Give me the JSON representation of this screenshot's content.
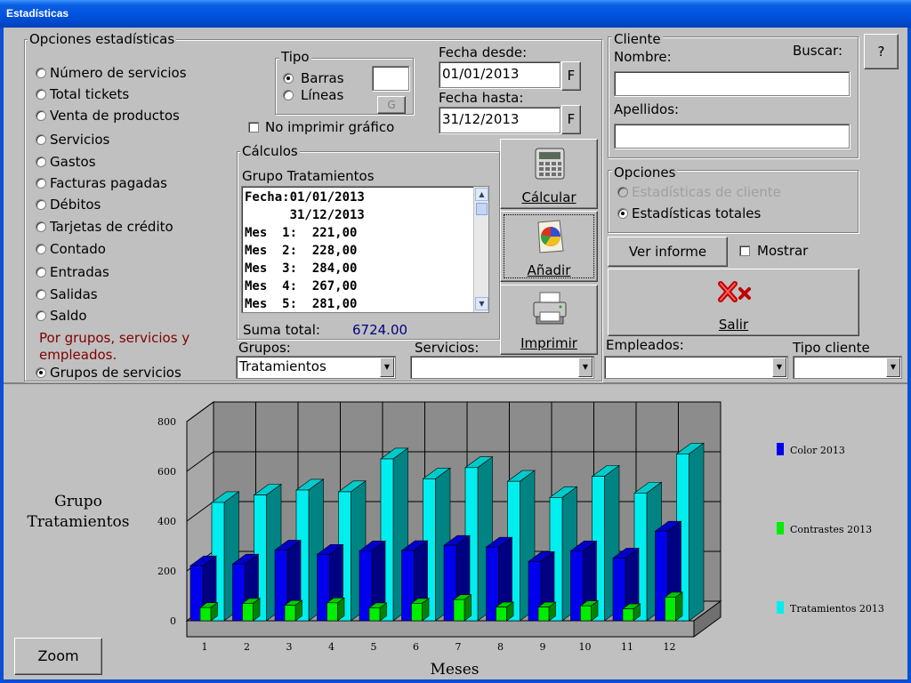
{
  "window": {
    "title": "Estadísticas"
  },
  "options_panel": {
    "legend": "Opciones estadísticas",
    "items": [
      {
        "label": "Número de servicios",
        "selected": false
      },
      {
        "label": "Total tickets",
        "selected": false
      },
      {
        "label": "Venta de productos",
        "selected": false
      },
      {
        "label": "Servicios",
        "selected": false
      },
      {
        "label": "Gastos",
        "selected": false
      },
      {
        "label": "Facturas pagadas",
        "selected": false
      },
      {
        "label": "Débitos",
        "selected": false
      },
      {
        "label": "Tarjetas de crédito",
        "selected": false
      },
      {
        "label": "Contado",
        "selected": false
      },
      {
        "label": "Entradas",
        "selected": false
      },
      {
        "label": "Salidas",
        "selected": false
      },
      {
        "label": "Saldo",
        "selected": false
      }
    ],
    "group_note": "Por grupos, servicios y empleados.",
    "group_note_color": "#800000",
    "group_item": {
      "label": "Grupos de servicios",
      "selected": true
    }
  },
  "tipo": {
    "legend": "Tipo",
    "barras": "Barras",
    "lineas": "Líneas",
    "selected": "Barras",
    "color_field_value": "",
    "g_button": "G"
  },
  "no_print": {
    "label": "No imprimir gráfico",
    "checked": false
  },
  "dates": {
    "from_label": "Fecha desde:",
    "from_value": "01/01/2013",
    "to_label": "Fecha hasta:",
    "to_value": "31/12/2013",
    "picker_label": "F"
  },
  "calculos": {
    "legend": "Cálculos",
    "group_title": "Grupo Tratamientos",
    "lines": [
      "Fecha:01/01/2013",
      "      31/12/2013",
      "Mes  1:  221,00",
      "Mes  2:  228,00",
      "Mes  3:  284,00",
      "Mes  4:  267,00",
      "Mes  5:  281,00"
    ],
    "total_label": "Suma total:",
    "total_value": "6724.00",
    "total_color": "#000080"
  },
  "actions": {
    "calcular": "Cálcular",
    "anadir": "Añadir",
    "imprimir": "Imprimir",
    "ver_informe": "Ver informe",
    "salir": "Salir",
    "help": "?"
  },
  "cliente": {
    "legend": "Cliente",
    "nombre_label": "Nombre:",
    "buscar_label": "Buscar:",
    "nombre_value": "",
    "apellidos_label": "Apellidos:",
    "apellidos_value": ""
  },
  "opciones": {
    "legend": "Opciones",
    "cliente_label": "Estadísticas de cliente",
    "totales_label": "Estadísticas totales",
    "selected": "Estadísticas totales"
  },
  "mostrar": {
    "label": "Mostrar",
    "checked": false
  },
  "filters": {
    "grupos_label": "Grupos:",
    "grupos_value": "Tratamientos",
    "servicios_label": "Servicios:",
    "servicios_value": "",
    "empleados_label": "Empleados:",
    "empleados_value": "",
    "tipo_cliente_label": "Tipo cliente",
    "tipo_cliente_value": ""
  },
  "zoom_button": "Zoom",
  "chart_data": {
    "type": "bar",
    "title": "Grupo Tratamientos",
    "xlabel": "Meses",
    "ylabel": "",
    "ylim": [
      0,
      800
    ],
    "yticks": [
      0,
      200,
      400,
      600,
      800
    ],
    "categories": [
      "1",
      "2",
      "3",
      "4",
      "5",
      "6",
      "7",
      "8",
      "9",
      "10",
      "11",
      "12"
    ],
    "series": [
      {
        "name": "Color 2013",
        "color": "#0000ee",
        "values": [
          221,
          228,
          284,
          267,
          281,
          282,
          303,
          296,
          238,
          281,
          252,
          360
        ]
      },
      {
        "name": "Contrastes 2013",
        "color": "#00ee00",
        "values": [
          53,
          70,
          62,
          72,
          52,
          70,
          85,
          55,
          55,
          60,
          48,
          95
        ]
      },
      {
        "name": "Tratamientos 2013",
        "color": "#00eeee",
        "values": [
          475,
          505,
          525,
          518,
          650,
          570,
          615,
          560,
          495,
          580,
          513,
          670
        ]
      }
    ],
    "grid": true,
    "legend_position": "right",
    "style": "3d"
  }
}
